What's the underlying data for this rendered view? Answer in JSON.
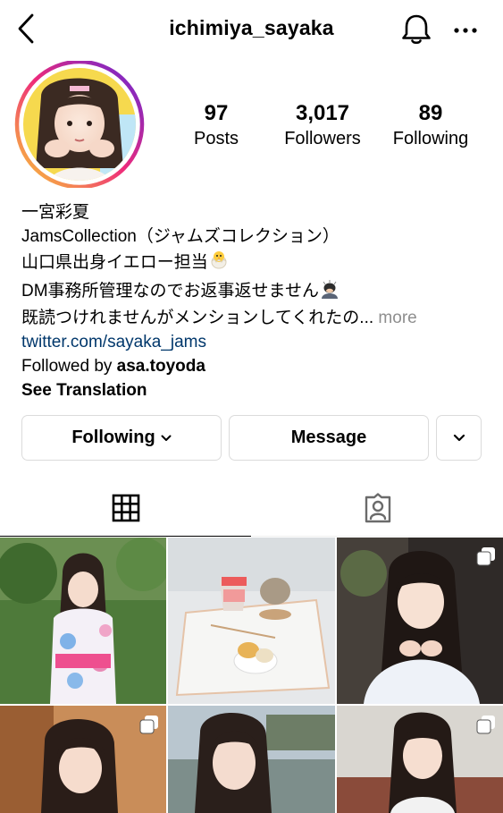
{
  "header": {
    "username": "ichimiya_sayaka",
    "icons": [
      "back-chevron-icon",
      "bell-icon",
      "more-dots-icon"
    ]
  },
  "profile": {
    "stats": [
      {
        "value": "97",
        "label": "Posts"
      },
      {
        "value": "3,017",
        "label": "Followers"
      },
      {
        "value": "89",
        "label": "Following"
      }
    ],
    "story_ring_colors": [
      "#f9ce34",
      "#ee2a7b",
      "#6228d7"
    ]
  },
  "bio": {
    "name": "一宮彩夏",
    "line1": "JamsCollection（ジャムズコレクション）",
    "line2": "山口県出身イエロー担当",
    "line3": "DM事務所管理なのでお返事返せません",
    "line4": "既読つけれませんがメンションしてくれたの...",
    "more": "more",
    "link": "twitter.com/sayaka_jams",
    "followed_by_prefix": "Followed by",
    "followed_by_user": "asa.toyoda",
    "see_translation": "See Translation"
  },
  "buttons": {
    "following": "Following",
    "message": "Message"
  },
  "tabs": [
    "grid-icon",
    "tagged-icon"
  ],
  "colors": {
    "link": "#00376b",
    "muted": "#8e8e8e",
    "border": "#dbdbdb"
  }
}
